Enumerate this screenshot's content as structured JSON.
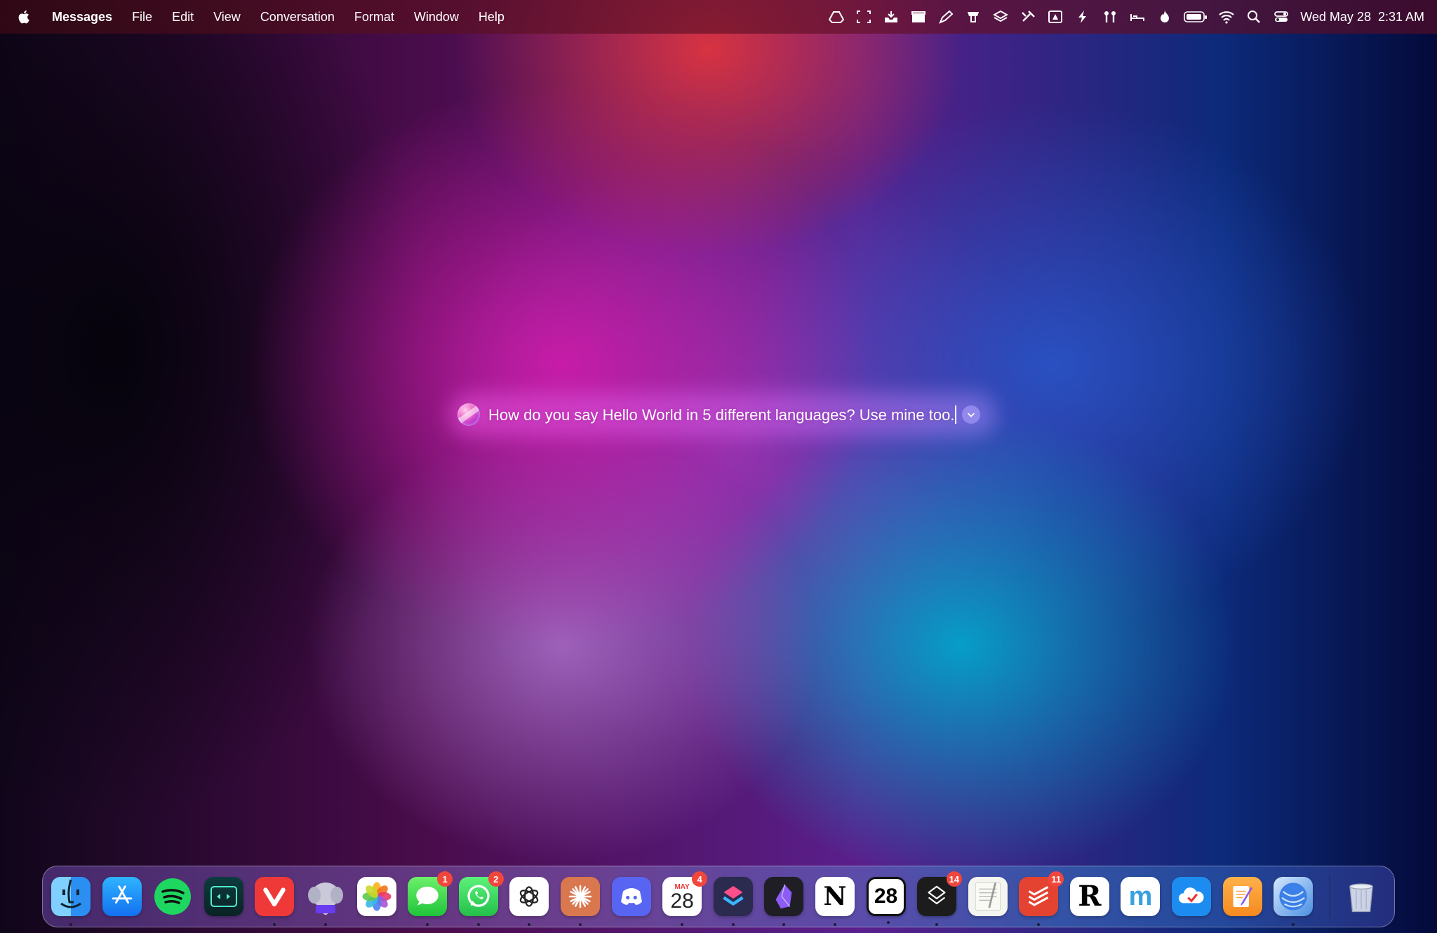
{
  "menubar": {
    "apple_icon": "apple-logo-icon",
    "app_name": "Messages",
    "items": [
      "File",
      "Edit",
      "View",
      "Conversation",
      "Format",
      "Window",
      "Help"
    ],
    "status_icons": [
      "google-drive-icon",
      "screenshot-icon",
      "inbox-tray-icon",
      "clapper-icon",
      "pen-icon",
      "popcorn-icon",
      "layers-icon",
      "tools-icon",
      "drive-triangle-icon",
      "bolt-icon",
      "airpods-icon",
      "bed-icon",
      "flame-icon",
      "battery-icon",
      "wifi-icon",
      "spotlight-search-icon",
      "control-center-icon"
    ],
    "clock": {
      "date": "Wed May 28",
      "time": "2:31 AM"
    }
  },
  "siri_prompt": {
    "text": "How do you say Hello World in 5 different languages? Use mine too.",
    "orb_icon": "siri-orb-icon",
    "submit_icon": "chevron-down-icon"
  },
  "dock": {
    "apps": [
      {
        "name": "finder",
        "glyph": "",
        "running": true
      },
      {
        "name": "app-store",
        "glyph": "",
        "running": false
      },
      {
        "name": "spotify",
        "glyph": "",
        "running": false
      },
      {
        "name": "infuse",
        "glyph": "",
        "running": false
      },
      {
        "name": "vivaldi",
        "glyph": "",
        "running": true
      },
      {
        "name": "tableplus",
        "glyph": "",
        "running": true
      },
      {
        "name": "photos",
        "glyph": "",
        "running": false
      },
      {
        "name": "messages",
        "glyph": "",
        "running": true,
        "badge": "1"
      },
      {
        "name": "whatsapp",
        "glyph": "",
        "running": true,
        "badge": "2"
      },
      {
        "name": "chatgpt",
        "glyph": "",
        "running": true
      },
      {
        "name": "claude",
        "glyph": "",
        "running": true
      },
      {
        "name": "discord",
        "glyph": "",
        "running": false
      },
      {
        "name": "calendar",
        "glyph": "28",
        "month": "MAY",
        "running": true,
        "badge": "4"
      },
      {
        "name": "shortcuts",
        "glyph": "",
        "running": true
      },
      {
        "name": "obsidian",
        "glyph": "",
        "running": true
      },
      {
        "name": "notion",
        "glyph": "N",
        "running": true
      },
      {
        "name": "fantastical",
        "glyph": "28",
        "running": true
      },
      {
        "name": "craft",
        "glyph": "",
        "running": true,
        "badge": "14"
      },
      {
        "name": "textedit",
        "glyph": "",
        "running": false
      },
      {
        "name": "todoist",
        "glyph": "",
        "running": true,
        "badge": "11"
      },
      {
        "name": "reeder",
        "glyph": "R",
        "running": false
      },
      {
        "name": "mimestream",
        "glyph": "m",
        "running": false
      },
      {
        "name": "cloudmounter",
        "glyph": "",
        "running": false
      },
      {
        "name": "pages",
        "glyph": "",
        "running": false
      },
      {
        "name": "wallpaper-app",
        "glyph": "",
        "running": true
      }
    ],
    "trash": {
      "name": "trash",
      "icon": "trash-can-icon"
    }
  }
}
